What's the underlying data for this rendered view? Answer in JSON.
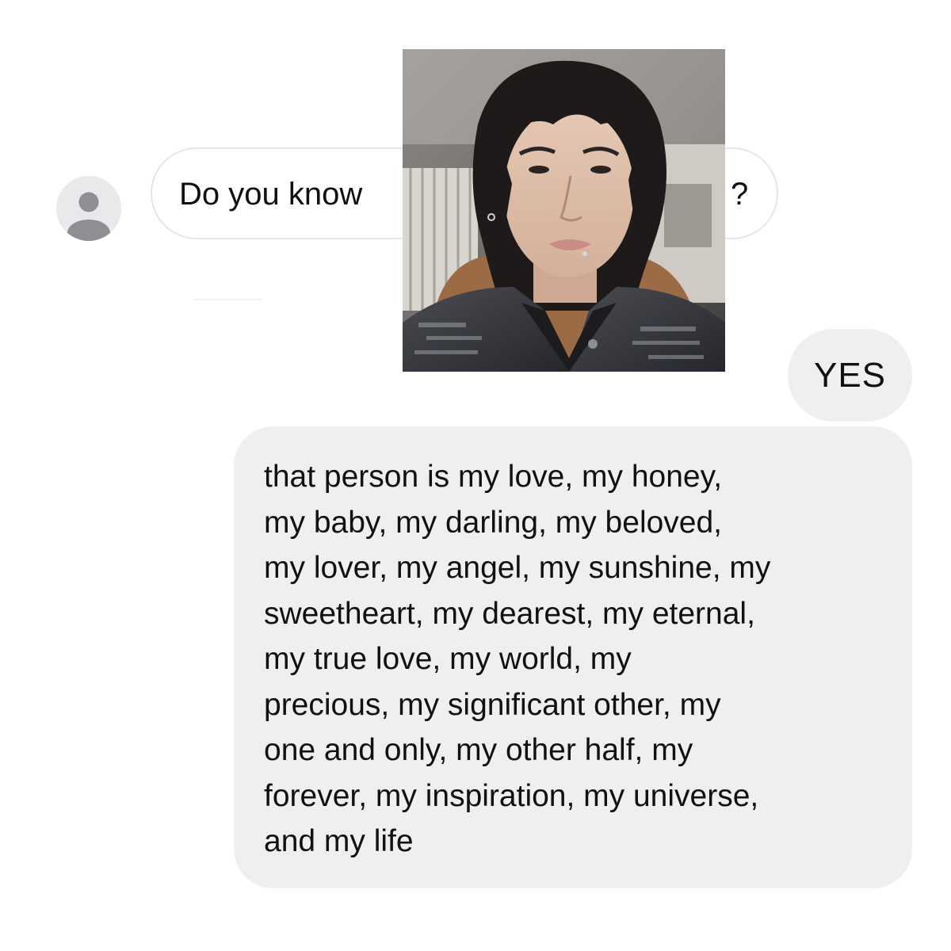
{
  "conversation": {
    "incoming": {
      "avatar_icon": "default-user-icon",
      "text_before_photo": "Do you know",
      "text_after_photo": "?"
    },
    "photo": {
      "description_icon": "selfie-photo"
    },
    "outgoing": [
      {
        "text": "YES"
      },
      {
        "lines": [
          "that person is my love, my honey,",
          "my baby, my darling, my beloved,",
          "my lover, my angel, my sunshine, my",
          "sweetheart, my dearest, my eternal,",
          "my true love, my world, my",
          "precious, my significant other, my",
          "one and only, my other half, my",
          "forever, my inspiration, my universe,",
          "and my life"
        ]
      }
    ]
  },
  "colors": {
    "incoming_border": "#e6e6e8",
    "outgoing_bg": "#efefef",
    "text": "#111111",
    "avatar_bg": "#e9e9ec",
    "avatar_fg": "#8e8e93"
  }
}
